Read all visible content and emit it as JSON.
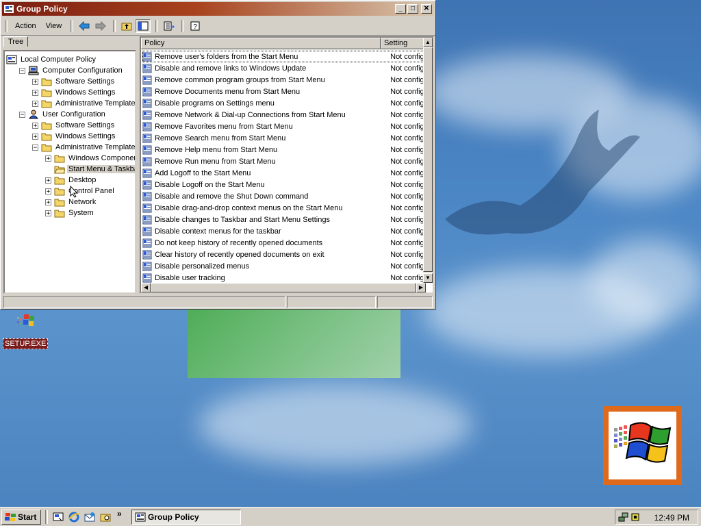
{
  "window": {
    "title": "Group Policy"
  },
  "menu": {
    "action": "Action",
    "view": "View"
  },
  "tab": {
    "tree": "Tree"
  },
  "tree": [
    {
      "label": "Local Computer Policy",
      "level": 0,
      "expander": "",
      "icon": "computer-policy-icon"
    },
    {
      "label": "Computer Configuration",
      "level": 1,
      "expander": "-",
      "icon": "computer-icon"
    },
    {
      "label": "Software Settings",
      "level": 2,
      "expander": "+",
      "icon": "folder-icon"
    },
    {
      "label": "Windows Settings",
      "level": 2,
      "expander": "+",
      "icon": "folder-icon"
    },
    {
      "label": "Administrative Templates",
      "level": 2,
      "expander": "+",
      "icon": "folder-icon"
    },
    {
      "label": "User Configuration",
      "level": 1,
      "expander": "-",
      "icon": "user-icon"
    },
    {
      "label": "Software Settings",
      "level": 2,
      "expander": "+",
      "icon": "folder-icon"
    },
    {
      "label": "Windows Settings",
      "level": 2,
      "expander": "+",
      "icon": "folder-icon"
    },
    {
      "label": "Administrative Templates",
      "level": 2,
      "expander": "-",
      "icon": "folder-icon"
    },
    {
      "label": "Windows Components",
      "level": 3,
      "expander": "+",
      "icon": "folder-icon"
    },
    {
      "label": "Start Menu & Taskbar",
      "level": 3,
      "expander": "",
      "icon": "folder-open-icon",
      "selected": true
    },
    {
      "label": "Desktop",
      "level": 3,
      "expander": "+",
      "icon": "folder-icon"
    },
    {
      "label": "Control Panel",
      "level": 3,
      "expander": "+",
      "icon": "folder-icon"
    },
    {
      "label": "Network",
      "level": 3,
      "expander": "+",
      "icon": "folder-icon"
    },
    {
      "label": "System",
      "level": 3,
      "expander": "+",
      "icon": "folder-icon"
    }
  ],
  "list": {
    "columns": [
      "Policy",
      "Setting"
    ],
    "rows": [
      {
        "policy": "Remove user's folders from the Start Menu",
        "setting": "Not configu"
      },
      {
        "policy": "Disable and remove links to Windows Update",
        "setting": "Not configu"
      },
      {
        "policy": "Remove common program groups from Start Menu",
        "setting": "Not configu"
      },
      {
        "policy": "Remove Documents menu from Start Menu",
        "setting": "Not configu"
      },
      {
        "policy": "Disable programs on Settings menu",
        "setting": "Not configu"
      },
      {
        "policy": "Remove Network & Dial-up Connections from Start Menu",
        "setting": "Not configu"
      },
      {
        "policy": "Remove Favorites menu from Start Menu",
        "setting": "Not configu"
      },
      {
        "policy": "Remove Search menu from Start Menu",
        "setting": "Not configu"
      },
      {
        "policy": "Remove Help menu from Start Menu",
        "setting": "Not configu"
      },
      {
        "policy": "Remove Run menu from Start Menu",
        "setting": "Not configu"
      },
      {
        "policy": "Add Logoff to the Start Menu",
        "setting": "Not configu"
      },
      {
        "policy": "Disable Logoff on the Start Menu",
        "setting": "Not configu"
      },
      {
        "policy": "Disable and remove the Shut Down command",
        "setting": "Not configu"
      },
      {
        "policy": "Disable drag-and-drop context menus on the Start Menu",
        "setting": "Not configu"
      },
      {
        "policy": "Disable changes to Taskbar and Start Menu Settings",
        "setting": "Not configu"
      },
      {
        "policy": "Disable context menus for the taskbar",
        "setting": "Not configu"
      },
      {
        "policy": "Do not keep history of recently opened documents",
        "setting": "Not configu"
      },
      {
        "policy": "Clear history of recently opened documents on exit",
        "setting": "Not configu"
      },
      {
        "policy": "Disable personalized menus",
        "setting": "Not configu"
      },
      {
        "policy": "Disable user tracking",
        "setting": "Not configu"
      }
    ]
  },
  "desktop": {
    "icon_label": "SETUP.EXE"
  },
  "taskbar": {
    "start": "Start",
    "task_button": "Group Policy",
    "clock": "12:49 PM"
  },
  "colors": {
    "title_start": "#7b1e12",
    "title_end": "#d8c8b0",
    "desktop": "#4a85c4",
    "chrome": "#d4d0c8"
  }
}
